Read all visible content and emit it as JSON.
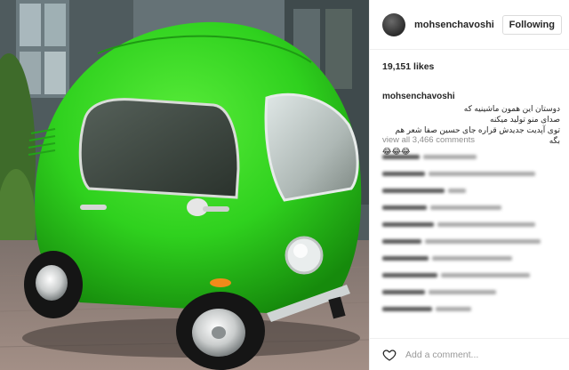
{
  "post": {
    "username": "mohsenchavoshi",
    "follow_label": "Following",
    "likes": "19,151 likes",
    "caption_user": "mohsenchavoshi",
    "caption_lines": [
      "دوستان این همون ماشینیه که",
      "صدای منو تولید میکنه",
      "توی آپدیت جدیدش قراره جای حسین صفا شعر هم بگه"
    ],
    "caption_emoji": "😂😂😂",
    "view_all": "view all 3,466 comments",
    "add_comment_placeholder": "Add a comment..."
  },
  "icons": {
    "avatar": "profile-avatar",
    "like": "heart-icon"
  },
  "colors": {
    "car_body": "#2fd11e",
    "car_shadow": "#1d9a12",
    "border": "#efefef",
    "muted_text": "#8e8e8e"
  }
}
